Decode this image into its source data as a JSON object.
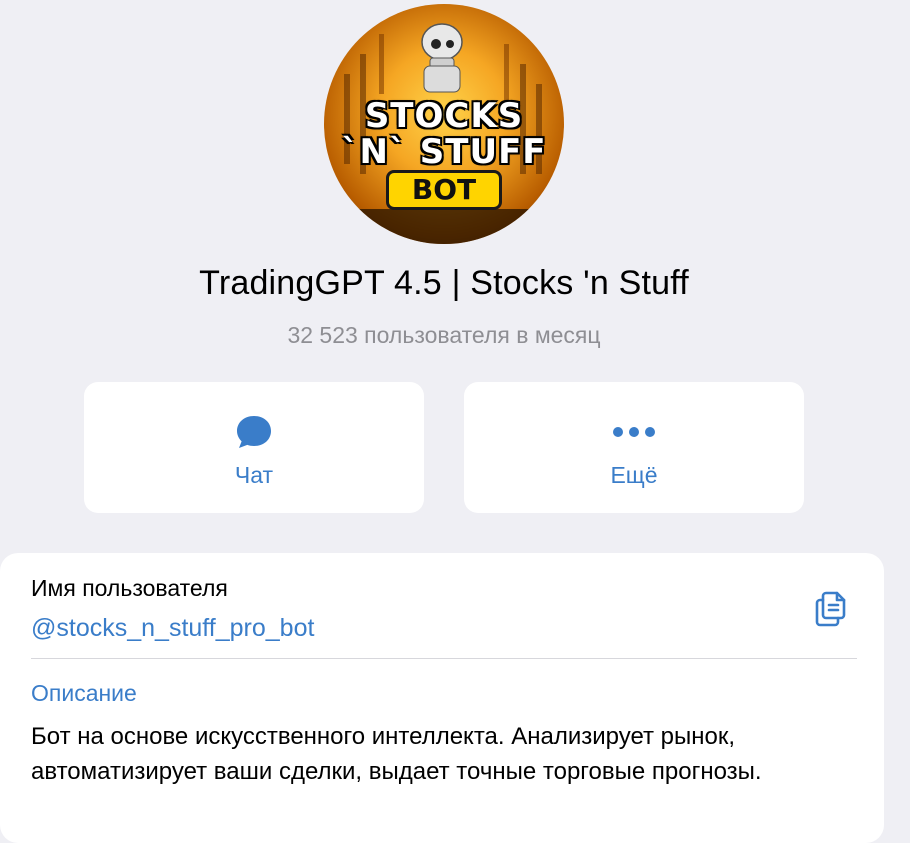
{
  "profile": {
    "title": "TradingGPT 4.5 | Stocks 'n Stuff",
    "subtitle": "32 523 пользователя в месяц",
    "avatar": {
      "line1": "STOCKS",
      "line2": "`N` STUFF",
      "badge": "BOT"
    }
  },
  "actions": {
    "chat": {
      "label": "Чат",
      "icon": "chat-bubble-icon"
    },
    "more": {
      "label": "Ещё",
      "icon": "more-dots-icon"
    }
  },
  "info": {
    "username_label": "Имя пользователя",
    "username": "@stocks_n_stuff_pro_bot",
    "copy_icon": "copy-icon",
    "description_label": "Описание",
    "description": "Бот на основе искусственного интеллекта. Анализирует рынок, автоматизирует ваши сделки, выдает точные торговые прогнозы."
  },
  "colors": {
    "background": "#efeff4",
    "card": "#ffffff",
    "accent": "#3a7dc9",
    "secondary_text": "#8e8e93"
  }
}
